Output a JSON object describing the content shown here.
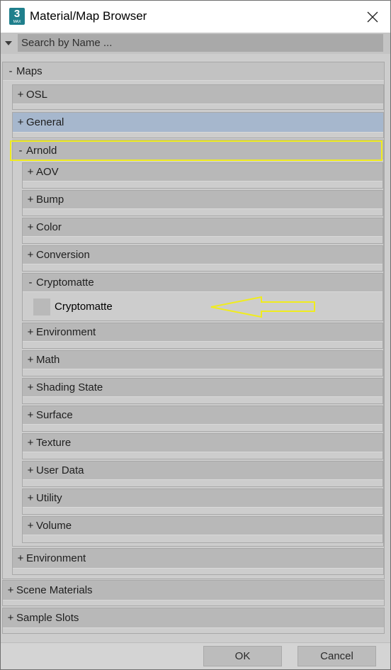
{
  "window": {
    "title": "Material/Map Browser",
    "app_icon_text": "3",
    "app_icon_sub": "MAX"
  },
  "search": {
    "placeholder": "Search by Name ..."
  },
  "tree": {
    "maps": {
      "sign": "-",
      "label": "Maps"
    },
    "osl": {
      "sign": "+",
      "label": "OSL"
    },
    "general": {
      "sign": "+",
      "label": "General"
    },
    "arnold": {
      "sign": "-",
      "label": "Arnold"
    },
    "arnold_children": [
      {
        "sign": "+",
        "label": "AOV"
      },
      {
        "sign": "+",
        "label": "Bump"
      },
      {
        "sign": "+",
        "label": "Color"
      },
      {
        "sign": "+",
        "label": "Conversion"
      },
      {
        "sign": "-",
        "label": "Cryptomatte"
      },
      {
        "sign": "+",
        "label": "Environment"
      },
      {
        "sign": "+",
        "label": "Math"
      },
      {
        "sign": "+",
        "label": "Shading State"
      },
      {
        "sign": "+",
        "label": "Surface"
      },
      {
        "sign": "+",
        "label": "Texture"
      },
      {
        "sign": "+",
        "label": "User Data"
      },
      {
        "sign": "+",
        "label": "Utility"
      },
      {
        "sign": "+",
        "label": "Volume"
      }
    ],
    "cryptomatte_item": {
      "label": "Cryptomatte"
    },
    "environment": {
      "sign": "+",
      "label": "Environment"
    },
    "scene_materials": {
      "sign": "+",
      "label": "Scene Materials"
    },
    "sample_slots": {
      "sign": "+",
      "label": "Sample Slots"
    }
  },
  "buttons": {
    "ok": "OK",
    "cancel": "Cancel"
  },
  "colors": {
    "highlight_annotation": "#f0ec1e",
    "selected_row": "#a6b7cd",
    "app_icon": "#1f7f8c"
  }
}
